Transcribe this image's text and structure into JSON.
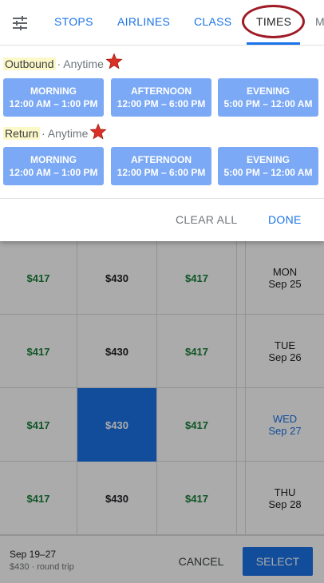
{
  "tabs": [
    "STOPS",
    "AIRLINES",
    "CLASS",
    "TIMES",
    "M"
  ],
  "active_tab": "TIMES",
  "outbound": {
    "name": "Outbound",
    "rest": "· Anytime",
    "options": [
      {
        "label": "MORNING",
        "range": "12:00 AM – 1:00 PM"
      },
      {
        "label": "AFTERNOON",
        "range": "12:00 PM – 6:00 PM"
      },
      {
        "label": "EVENING",
        "range": "5:00 PM – 12:00 AM"
      }
    ]
  },
  "return": {
    "name": "Return",
    "rest": "· Anytime",
    "options": [
      {
        "label": "MORNING",
        "range": "12:00 AM – 1:00 PM"
      },
      {
        "label": "AFTERNOON",
        "range": "12:00 PM – 6:00 PM"
      },
      {
        "label": "EVENING",
        "range": "5:00 PM – 12:00 AM"
      }
    ]
  },
  "actions": {
    "clear": "CLEAR ALL",
    "done": "DONE"
  },
  "grid": [
    {
      "prices": [
        "$417",
        "$430",
        "$417"
      ],
      "day": "MON",
      "date": "Sep 25"
    },
    {
      "prices": [
        "$417",
        "$430",
        "$417"
      ],
      "day": "TUE",
      "date": "Sep 26"
    },
    {
      "prices": [
        "$417",
        "$430",
        "$417"
      ],
      "day": "WED",
      "date": "Sep 27"
    },
    {
      "prices": [
        "$417",
        "$430",
        "$417"
      ],
      "day": "THU",
      "date": "Sep 28"
    }
  ],
  "bottom": {
    "range": "Sep 19–27",
    "price_line": "$430 · round trip",
    "cancel": "CANCEL",
    "select": "SELECT"
  },
  "colors": {
    "accent": "#1a73e8",
    "option_bg": "#7ba9f5",
    "price_green": "#188038",
    "annotation": "#9e1b26",
    "star": "#d93025"
  }
}
